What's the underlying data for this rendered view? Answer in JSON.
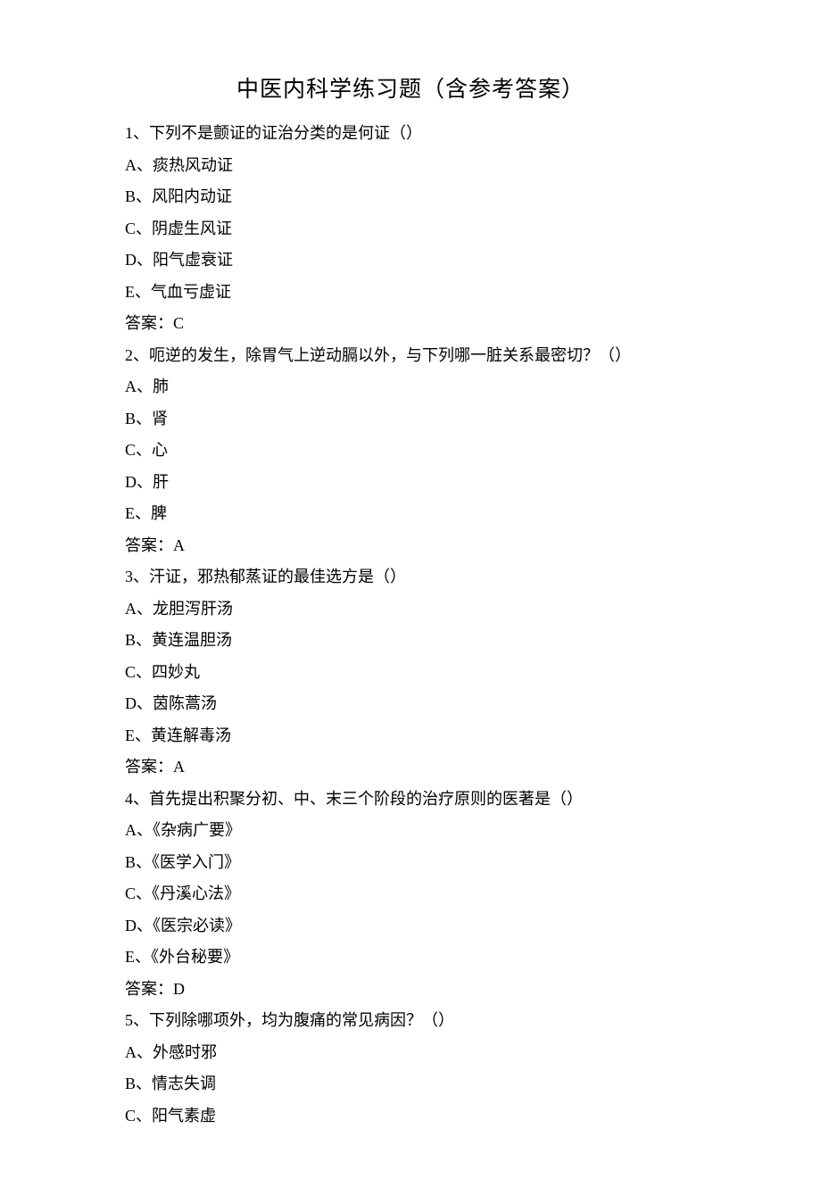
{
  "title": "中医内科学练习题（含参考答案）",
  "questions": [
    {
      "stem": "1、下列不是颤证的证治分类的是何证（）",
      "options": [
        "A、痰热风动证",
        "B、风阳内动证",
        "C、阴虚生风证",
        "D、阳气虚衰证",
        "E、气血亏虚证"
      ],
      "answer": "答案：C"
    },
    {
      "stem": "2、呃逆的发生，除胃气上逆动膈以外，与下列哪一脏关系最密切？（）",
      "options": [
        "A、肺",
        "B、肾",
        "C、心",
        "D、肝",
        "E、脾"
      ],
      "answer": "答案：A"
    },
    {
      "stem": "3、汗证，邪热郁蒸证的最佳选方是（）",
      "options": [
        "A、龙胆泻肝汤",
        "B、黄连温胆汤",
        "C、四妙丸",
        "D、茵陈蒿汤",
        "E、黄连解毒汤"
      ],
      "answer": "答案：A"
    },
    {
      "stem": "4、首先提出积聚分初、中、末三个阶段的治疗原则的医著是（）",
      "options": [
        "A、《杂病广要》",
        "B、《医学入门》",
        "C、《丹溪心法》",
        "D、《医宗必读》",
        "E、《外台秘要》"
      ],
      "answer": "答案：D"
    },
    {
      "stem": "5、下列除哪项外，均为腹痛的常见病因？（）",
      "options": [
        "A、外感时邪",
        "B、情志失调",
        "C、阳气素虚"
      ]
    }
  ]
}
